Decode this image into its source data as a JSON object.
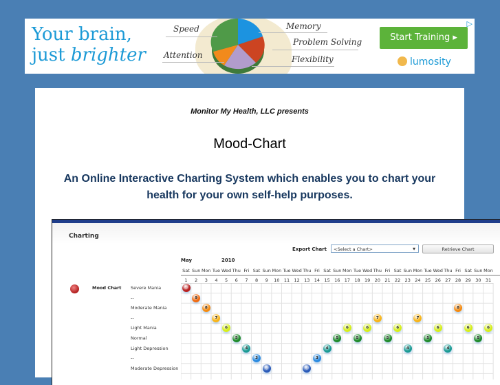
{
  "ad": {
    "headline_line1": "Your brain,",
    "headline_line2_plain": "just ",
    "headline_line2_italic": "brighter",
    "labels": {
      "speed": "Speed",
      "memory": "Memory",
      "problem_solving": "Problem Solving",
      "attention": "Attention",
      "flexibility": "Flexibility"
    },
    "cta": "Start Training ▸",
    "brand": "lumosity",
    "choices_icon": "adchoices-icon",
    "colors": {
      "headline": "#1c9ad6",
      "cta": "#5cb33a"
    }
  },
  "page": {
    "presents": "Monitor My Health, LLC presents",
    "title": "Mood-Chart",
    "tagline": "An Online Interactive Charting System which enables you to chart your health for your own self-help purposes.",
    "background": "#4a7fb4",
    "tagline_color": "#17375e"
  },
  "chart_app": {
    "section_title": "Charting",
    "export_label": "Export Chart",
    "export_select_value": "<Select a Chart>",
    "retrieve_button": "Retrieve Chart",
    "month": "May",
    "year": "2010",
    "chart_name": "Mood Chart"
  },
  "chart_data": {
    "type": "scatter",
    "title": "Mood Chart",
    "xlabel": "May 2010",
    "days": [
      1,
      2,
      3,
      4,
      5,
      6,
      7,
      8,
      9,
      10,
      11,
      12,
      13,
      14,
      15,
      16,
      17,
      18,
      19,
      20,
      21,
      22,
      23,
      24,
      25,
      26,
      27,
      28,
      29,
      30,
      31
    ],
    "weekdays": [
      "Sat",
      "Sun",
      "Mon",
      "Tue",
      "Wed",
      "Thu",
      "Fri",
      "Sat",
      "Sun",
      "Mon",
      "Tue",
      "Wed",
      "Thu",
      "Fri",
      "Sat",
      "Sun",
      "Mon",
      "Tue",
      "Wed",
      "Thu",
      "Fri",
      "Sat",
      "Sun",
      "Mon",
      "Tue",
      "Wed",
      "Thu",
      "Fri",
      "Sat",
      "Sun",
      "Mon"
    ],
    "rows": [
      {
        "label": "Severe Mania",
        "value": 10
      },
      {
        "label": "--",
        "value": 9
      },
      {
        "label": "Moderate Mania",
        "value": 8
      },
      {
        "label": "--",
        "value": 7
      },
      {
        "label": "Light Mania",
        "value": 6
      },
      {
        "label": "Normal",
        "value": 5
      },
      {
        "label": "Light Depression",
        "value": 4
      },
      {
        "label": "--",
        "value": 3
      },
      {
        "label": "Moderate Depression",
        "value": 2
      }
    ],
    "points": [
      {
        "day": 1,
        "value": 10
      },
      {
        "day": 2,
        "value": 9
      },
      {
        "day": 3,
        "value": 8
      },
      {
        "day": 4,
        "value": 7
      },
      {
        "day": 5,
        "value": 6
      },
      {
        "day": 6,
        "value": 5
      },
      {
        "day": 7,
        "value": 4
      },
      {
        "day": 8,
        "value": 3
      },
      {
        "day": 9,
        "value": 2
      },
      {
        "day": 13,
        "value": 2
      },
      {
        "day": 14,
        "value": 3
      },
      {
        "day": 15,
        "value": 4
      },
      {
        "day": 16,
        "value": 5
      },
      {
        "day": 17,
        "value": 6
      },
      {
        "day": 18,
        "value": 5
      },
      {
        "day": 19,
        "value": 6
      },
      {
        "day": 20,
        "value": 7
      },
      {
        "day": 21,
        "value": 5
      },
      {
        "day": 22,
        "value": 6
      },
      {
        "day": 23,
        "value": 4
      },
      {
        "day": 24,
        "value": 7
      },
      {
        "day": 25,
        "value": 5
      },
      {
        "day": 26,
        "value": 6
      },
      {
        "day": 27,
        "value": 4
      },
      {
        "day": 28,
        "value": 8
      },
      {
        "day": 29,
        "value": 6
      },
      {
        "day": 30,
        "value": 5
      },
      {
        "day": 31,
        "value": 6
      }
    ],
    "value_colors": {
      "10": "#b82020",
      "9": "#f06a10",
      "8": "#f48a10",
      "7": "#f8b418",
      "6": "#d6ee1a",
      "5": "#1e8a2a",
      "4": "#1a9a94",
      "3": "#2a8ae0",
      "2": "#2a5ab8"
    }
  }
}
